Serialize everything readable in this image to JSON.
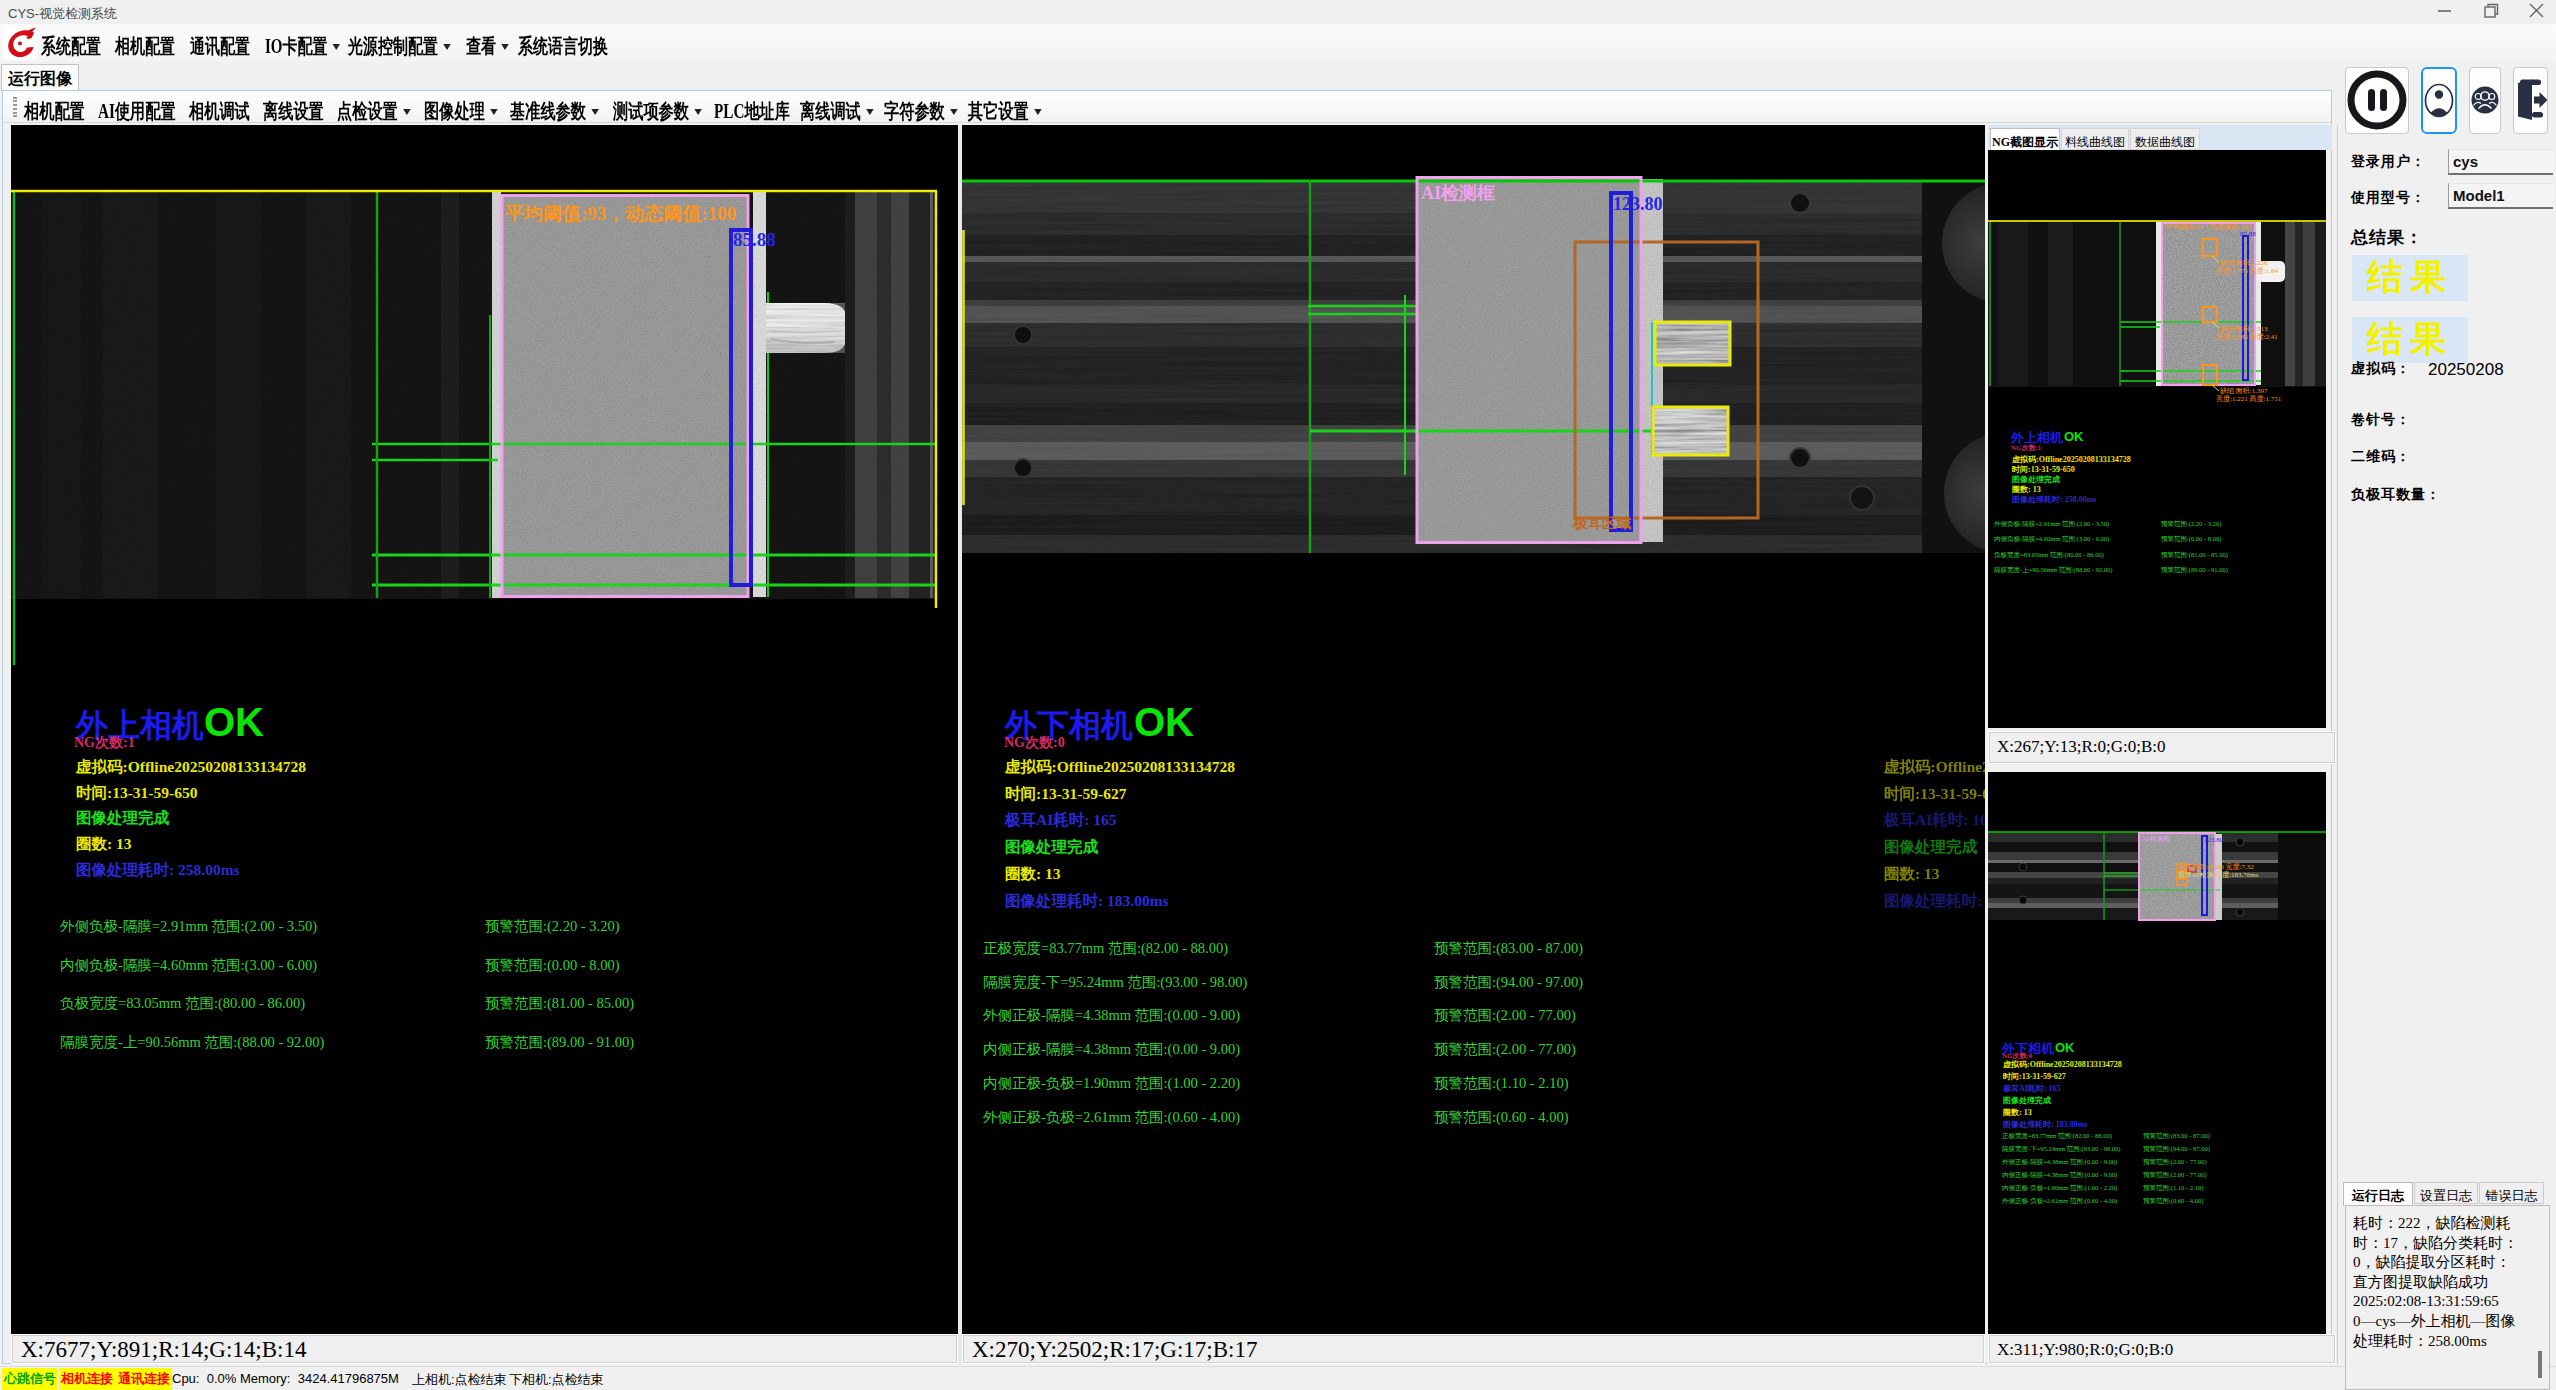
{
  "colors": {
    "overlay_yellow": "#e9e900",
    "overlay_green": "#17e217",
    "overlay_blue": "#2525e8",
    "overlay_pink": "#f2a0ef",
    "overlay_orange": "#ff9518",
    "overlay_chocolate": "#c2691f",
    "overlay_magenta": "#d22a64",
    "camera_title_blue": "#1b1bef",
    "camera_ok_green": "#09e509",
    "result_box_bg": "#d9e6f5",
    "status_chip_bg": "#ffff00",
    "status_chip_red": "#fd0202",
    "status_chip_green": "#00a400",
    "selected_button_border": "#1c97ea",
    "logo_red": "#d40d17"
  },
  "window": {
    "title": "CYS-视觉检测系统"
  },
  "menu": {
    "items": [
      {
        "label": "系统配置",
        "arrow": false
      },
      {
        "label": "相机配置",
        "arrow": false
      },
      {
        "label": "通讯配置",
        "arrow": false
      },
      {
        "label": "IO卡配置",
        "arrow": true
      },
      {
        "label": "光源控制配置",
        "arrow": true
      },
      {
        "label": "查看",
        "arrow": true
      },
      {
        "label": "系统语言切换",
        "arrow": false
      }
    ]
  },
  "run_tab_label": "运行图像",
  "toolbar": {
    "items": [
      {
        "label": "相机配置",
        "arrow": false
      },
      {
        "label": "AI使用配置",
        "arrow": false
      },
      {
        "label": "相机调试",
        "arrow": false
      },
      {
        "label": "离线设置",
        "arrow": false
      },
      {
        "label": "点检设置",
        "arrow": true
      },
      {
        "label": "图像处理",
        "arrow": true
      },
      {
        "label": "基准线参数",
        "arrow": true
      },
      {
        "label": "测试项参数",
        "arrow": true
      },
      {
        "label": "PLC地址库",
        "arrow": false
      },
      {
        "label": "离线调试",
        "arrow": true
      },
      {
        "label": "字符参数",
        "arrow": true
      },
      {
        "label": "其它设置",
        "arrow": true
      }
    ]
  },
  "left_camera": {
    "threshold_text": "平均阈值:93，动态阈值:100",
    "width_value": "85.88",
    "status": {
      "camera_name": "外上相机",
      "result": "OK",
      "ng_count": "NG次数:1",
      "rows": [
        {
          "text": "虚拟码:Offline20250208133134728",
          "color": "yellow"
        },
        {
          "text": "时间:13-31-59-650",
          "color": "yellow"
        },
        {
          "text": "图像处理完成",
          "color": "green"
        },
        {
          "text": "圈数: 13",
          "color": "yellow"
        },
        {
          "text": "图像处理耗时: 258.00ms",
          "color": "blue"
        }
      ]
    },
    "measurements": [
      {
        "left": "外侧负极-隔膜=2.91mm 范围:(2.00 - 3.50)",
        "right": "预警范围:(2.20 - 3.20)"
      },
      {
        "left": "内侧负极-隔膜=4.60mm 范围:(3.00 - 6.00)",
        "right": "预警范围:(0.00 - 8.00)"
      },
      {
        "left": "负极宽度=83.05mm 范围:(80.00 - 86.00)",
        "right": "预警范围:(81.00 - 85.00)"
      },
      {
        "left": "隔膜宽度-上=90.56mm 范围:(88.00 - 92.00)",
        "right": "预警范围:(89.00 - 91.00)"
      }
    ],
    "coord_bar": "X:7677;Y:891;R:14;G:14;B:14"
  },
  "right_camera": {
    "ai_box_label": "AI检测框",
    "width_value": "123.80",
    "tab_region_label": "极耳区域",
    "status": {
      "camera_name": "外下相机",
      "result": "OK",
      "ng_count": "NG次数:0",
      "rows": [
        {
          "text": "虚拟码:Offline20250208133134728",
          "color": "yellow"
        },
        {
          "text": "时间:13-31-59-627",
          "color": "yellow"
        },
        {
          "text": "极耳AI耗时: 165",
          "color": "blue"
        },
        {
          "text": "图像处理完成",
          "color": "green"
        },
        {
          "text": "圈数: 13",
          "color": "yellow"
        },
        {
          "text": "图像处理耗时: 183.00ms",
          "color": "blue"
        }
      ]
    },
    "measurements": [
      {
        "left": "正极宽度=83.77mm 范围:(82.00 - 88.00)",
        "right": "预警范围:(83.00 - 87.00)"
      },
      {
        "left": "隔膜宽度-下=95.24mm 范围:(93.00 - 98.00)",
        "right": "预警范围:(94.00 - 97.00)"
      },
      {
        "left": "外侧正极-隔膜=4.38mm 范围:(0.00 - 9.00)",
        "right": "预警范围:(2.00 - 77.00)"
      },
      {
        "left": "内侧正极-隔膜=4.38mm 范围:(0.00 - 9.00)",
        "right": "预警范围:(2.00 - 77.00)"
      },
      {
        "left": "内侧正极-负极=1.90mm 范围:(1.00 - 2.20)",
        "right": "预警范围:(1.10 - 2.10)"
      },
      {
        "left": "外侧正极-负极=2.61mm 范围:(0.60 - 4.00)",
        "right": "预警范围:(0.60 - 4.00)"
      }
    ],
    "coord_bar": "X:270;Y:2502;R:17;G:17;B:17"
  },
  "sidebar": {
    "tabs": [
      "NG截图显示",
      "料线曲线图",
      "数据曲线图"
    ],
    "thumb1_defects": [
      {
        "line1": "缺陷 面积:1.226",
        "line2": "亮度:1.775 高度:1.84"
      },
      {
        "line1": "缺陷 面积:1.513",
        "line2": "亮度:0.885 高度:2.41"
      },
      {
        "line1": "缺陷 面积:1.397",
        "line2": "亮度:1.221 高度:1.751"
      }
    ],
    "thumb2_defects": [
      {
        "line1": "极耳间距:89.06 宽度:7.32",
        "line2": "极耳AI检测 高度:183.76ms"
      }
    ],
    "coord_bar1": "X:267;Y:13;R:0;G:0;B:0",
    "coord_bar2": "X:311;Y:980;R:0;G:0;B:0"
  },
  "user_panel": {
    "pause_button": "pause",
    "user_button": "user",
    "users_button": "users",
    "exit_button": "exit",
    "login_label": "登录用户：",
    "login_value": "cys",
    "model_label": "使用型号：",
    "model_value": "Model1",
    "total_result_label": "总结果：",
    "result_boxes": [
      "结果",
      "结果"
    ],
    "fields": [
      {
        "label": "虚拟码：",
        "value": "20250208"
      },
      {
        "label": "卷针号：",
        "value": ""
      },
      {
        "label": "二维码：",
        "value": ""
      },
      {
        "label": "负极耳数量：",
        "value": ""
      }
    ]
  },
  "log_panel": {
    "tabs": [
      "运行日志",
      "设置日志",
      "错误日志"
    ],
    "lines": [
      "耗时：222，缺陷检测耗",
      "时：17，缺陷分类耗时：",
      "0，缺陷提取分区耗时：",
      "直方图提取缺陷成功",
      "2025:02:08-13:31:59:65",
      "0—cys—外上相机—图像",
      "处理耗时：258.00ms"
    ]
  },
  "status_bar": {
    "chips": [
      {
        "label": "心跳信号",
        "color": "green"
      },
      {
        "label": "相机连接",
        "color": "red"
      },
      {
        "label": "通讯连接",
        "color": "red"
      }
    ],
    "cpu_text": "Cpu:  0.0% Memory:  3424.41796875M",
    "camera_state_upper": "上相机:点检结束",
    "camera_state_lower": "下相机:点检结束"
  }
}
